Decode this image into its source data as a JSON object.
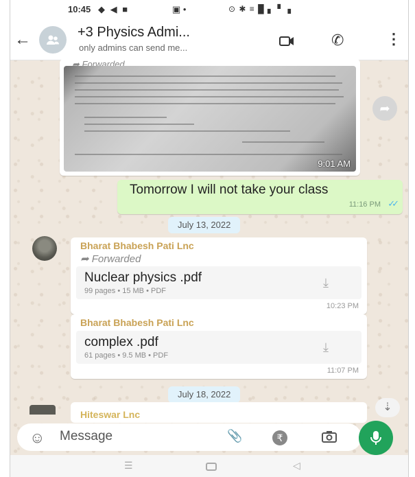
{
  "status_bar": {
    "time": "10:45",
    "left_icons": "◆ ◀ ■",
    "mid_icons": "▣ •",
    "right_icons": "⊙ ✱ ≡ █ ▖ ▘▗"
  },
  "header": {
    "title": "+3 Physics Admi...",
    "subtitle": "only admins can send me..."
  },
  "messages": {
    "image_forwarded": "Forwarded",
    "image_time": "9:01 AM",
    "outgoing_text": "Tomorrow I will not take your class",
    "outgoing_time": "11:16 PM"
  },
  "dates": {
    "first": "July 13, 2022",
    "second": "July 18, 2022"
  },
  "file_messages": [
    {
      "sender": "Bharat Bhabesh Pati Lnc",
      "forwarded": "Forwarded",
      "file_name": "Nuclear physics .pdf",
      "file_meta": "99 pages • 15 MB • PDF",
      "time": "10:23 PM"
    },
    {
      "sender": "Bharat Bhabesh Pati Lnc",
      "file_name": "complex .pdf",
      "file_meta": "61 pages • 9.5 MB • PDF",
      "time": "11:07 PM"
    }
  ],
  "partial_message": {
    "sender": "Hiteswar Lnc"
  },
  "input_bar": {
    "placeholder": "Message"
  },
  "colors": {
    "accent_green": "#21a35b",
    "outgoing_bubble": "#dcf8c6",
    "sender_name": "#c9a255",
    "read_ticks": "#4fb6ec"
  },
  "icons": [
    "back-arrow-icon",
    "group-avatar-icon",
    "video-call-icon",
    "phone-icon",
    "more-vert-icon",
    "share-icon",
    "download-icon",
    "double-check-icon",
    "scroll-down-icon",
    "emoji-icon",
    "attach-icon",
    "rupee-icon",
    "camera-icon",
    "mic-icon"
  ]
}
